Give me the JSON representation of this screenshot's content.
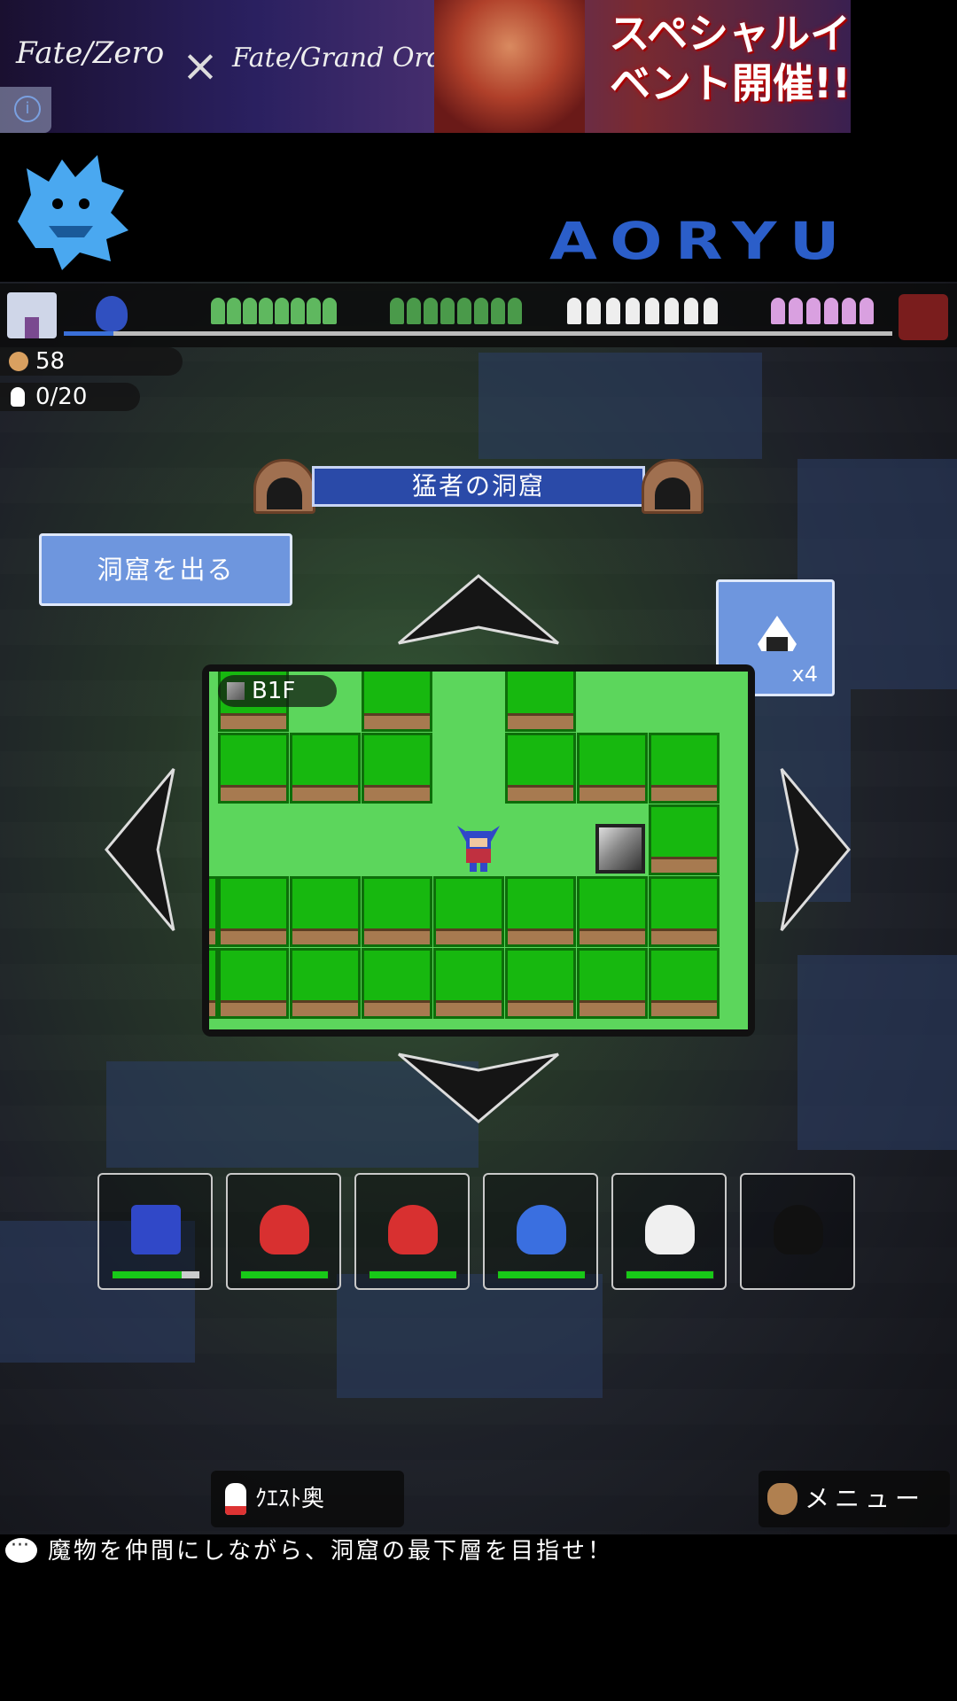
{
  "ad": {
    "logo_left": "Fate/Zero",
    "times": "×",
    "logo_right": "Fate/Grand Order",
    "headline": "スペシャルイベント開催!!",
    "info_icon": "info-icon"
  },
  "header": {
    "brand": "AORYU",
    "logo_icon": "blue-dragon-icon"
  },
  "progress": {
    "start_icon": "castle-icon",
    "end_icon": "demon-boss-icon",
    "fraction": 0.06
  },
  "resources": {
    "coins": "58",
    "capacity": "0/20"
  },
  "dungeon": {
    "name": "猛者の洞窟",
    "floor": "B1F",
    "exit_label": "洞窟を出る"
  },
  "item": {
    "icon": "rice-ball-icon",
    "count": "x4"
  },
  "party": [
    {
      "name": "hero",
      "hp": 0.8
    },
    {
      "name": "red-bird",
      "hp": 1.0
    },
    {
      "name": "red-bird",
      "hp": 1.0
    },
    {
      "name": "blue-slime",
      "hp": 1.0
    },
    {
      "name": "white-slime",
      "hp": 1.0
    },
    {
      "name": "empty",
      "hp": null
    }
  ],
  "bottom": {
    "quest_label": "ｸｴｽﾄ奥",
    "menu_label": "メニュー",
    "message": "魔物を仲間にしながら、洞窟の最下層を目指せ！"
  },
  "colors": {
    "accent_blue": "#6e96de",
    "plate_blue": "#2a4aa8",
    "grass": "#17b80f",
    "hp_green": "#18c918"
  }
}
